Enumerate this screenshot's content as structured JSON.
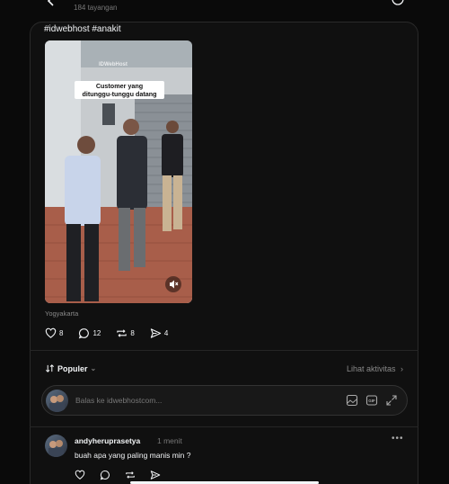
{
  "header": {
    "views": "184 tayangan"
  },
  "post": {
    "caption": "#idwebhost #anakit",
    "video": {
      "watermark": "IDWebHost",
      "overlay_caption_line1": "Customer yang",
      "overlay_caption_line2": "ditunggu-tunggu datang",
      "muted": true
    },
    "location": "Yogyakarta",
    "stats": {
      "likes": "8",
      "comments": "12",
      "reposts": "8",
      "shares": "4"
    }
  },
  "replies_section": {
    "sort_label": "Populer",
    "activity_link": "Lihat aktivitas",
    "reply_placeholder": "Balas ke idwebhostcom..."
  },
  "comments": [
    {
      "username": "andyheruprasetya",
      "time": "1 menit",
      "text": "buah apa yang paling manis min ?"
    }
  ],
  "colors": {
    "background": "#0a0a0a",
    "card": "#101010",
    "text": "#f3f5f7",
    "muted": "#777777"
  }
}
